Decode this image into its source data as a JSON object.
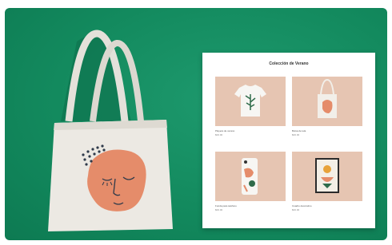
{
  "catalog": {
    "title": "Colección de Verano",
    "products": [
      {
        "name": "Playera de verano",
        "price": "$00.00",
        "image": "tshirt-image"
      },
      {
        "name": "Bolsa de tela",
        "price": "$00.00",
        "image": "tote-bag-image"
      },
      {
        "name": "Funda para teléfono",
        "price": "$00.00",
        "image": "phone-case-image"
      },
      {
        "name": "Cuadro decorativo",
        "price": "$00.00",
        "image": "framed-print-image"
      }
    ]
  },
  "colors": {
    "wall": "#138a5e",
    "bag": "#ece9e3",
    "accent": "#e58c6a",
    "tile": "#e6c5b2"
  }
}
